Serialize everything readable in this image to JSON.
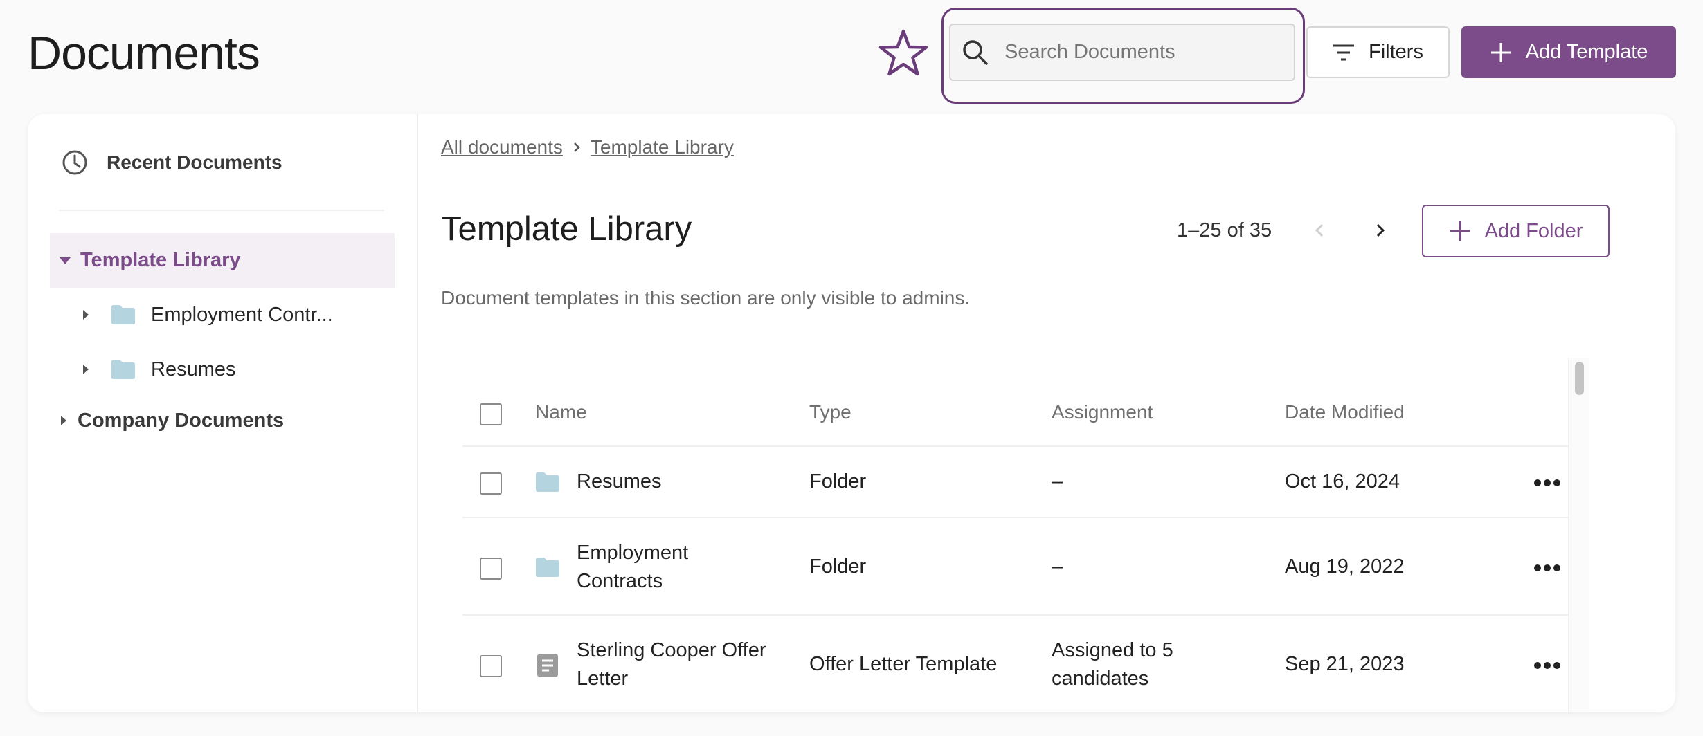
{
  "header": {
    "title": "Documents",
    "search_placeholder": "Search Documents",
    "filters_label": "Filters",
    "add_template_label": "Add Template"
  },
  "sidebar": {
    "recent_label": "Recent Documents",
    "tree": {
      "template_library": "Template Library",
      "children": [
        "Employment Contr...",
        "Resumes"
      ],
      "company_documents": "Company Documents"
    }
  },
  "breadcrumb": [
    "All documents",
    "Template Library"
  ],
  "section": {
    "title": "Template Library",
    "pagination": "1–25 of 35",
    "add_folder_label": "Add Folder",
    "description": "Document templates in this section are only visible to admins."
  },
  "table": {
    "columns": [
      "Name",
      "Type",
      "Assignment",
      "Date Modified"
    ],
    "rows": [
      {
        "name": "Resumes",
        "name_line2": "",
        "icon": "folder-icon",
        "type": "Folder",
        "assignment": "–",
        "assignment_line2": "",
        "date": "Oct 16, 2024"
      },
      {
        "name": "Employment",
        "name_line2": "Contracts",
        "icon": "folder-icon",
        "type": "Folder",
        "assignment": "–",
        "assignment_line2": "",
        "date": "Aug 19, 2022"
      },
      {
        "name": "Sterling Cooper Offer",
        "name_line2": "Letter",
        "icon": "document-icon",
        "type": "Offer Letter Template",
        "assignment": "Assigned to 5",
        "assignment_line2": "candidates",
        "date": "Sep 21, 2023"
      }
    ]
  },
  "colors": {
    "accent": "#7b4c89",
    "folder": "#b4d5df",
    "selected_bg": "#f3eff4"
  }
}
